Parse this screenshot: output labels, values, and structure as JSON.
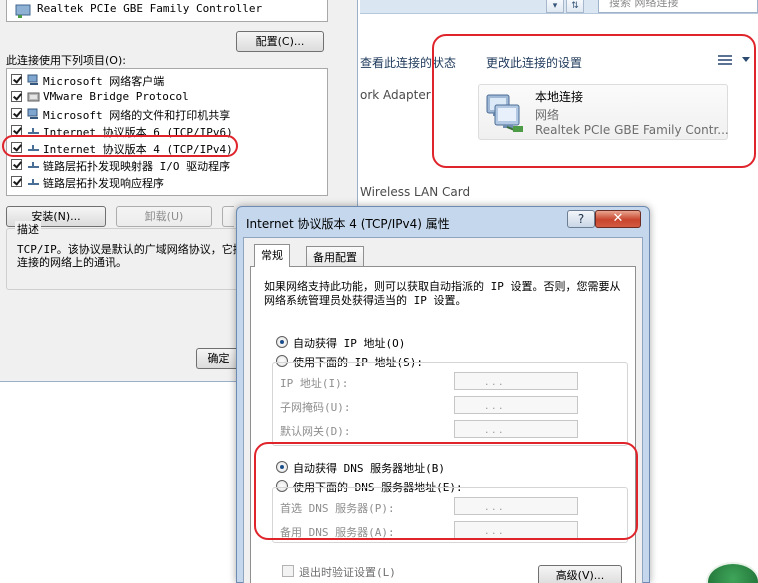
{
  "explorer": {
    "search_placeholder": "搜索 网络连接",
    "cmd_status": "查看此连接的状态",
    "cmd_settings": "更改此连接的设置",
    "adapter_row1": "ork Adapter",
    "adapter_row2": "Wireless LAN Card",
    "lan": {
      "name": "本地连接",
      "status": "网络",
      "device": "Realtek PCIe GBE Family Contr..."
    }
  },
  "props": {
    "device": "Realtek PCIe GBE Family Controller",
    "configure_button": "配置(C)...",
    "uses_label": "此连接使用下列项目(O):",
    "items": [
      {
        "label": "Microsoft 网络客户端",
        "checked": true
      },
      {
        "label": "VMware Bridge Protocol",
        "checked": true
      },
      {
        "label": "Microsoft 网络的文件和打印机共享",
        "checked": true
      },
      {
        "label": "Internet 协议版本 6 (TCP/IPv6)",
        "checked": true
      },
      {
        "label": "Internet 协议版本 4 (TCP/IPv4)",
        "checked": true
      },
      {
        "label": "链路层拓扑发现映射器 I/O 驱动程序",
        "checked": true
      },
      {
        "label": "链路层拓扑发现响应程序",
        "checked": true
      }
    ],
    "install_button": "安装(N)...",
    "uninstall_button": "卸载(U)",
    "desc_title": "描述",
    "desc_text": "TCP/IP。该协议是默认的广域网络协议，它提供在不同的相互连接的网络上的通讯。",
    "ok_button": "确定"
  },
  "dialog": {
    "title": "Internet 协议版本 4 (TCP/IPv4) 属性",
    "help_button": "?",
    "close_button": "✕",
    "tab_general": "常规",
    "tab_alternate": "备用配置",
    "intro": "如果网络支持此功能，则可以获取自动指派的 IP 设置。否则，您需要从网络系统管理员处获得适当的 IP 设置。",
    "auto_ip": "自动获得 IP 地址(O)",
    "manual_ip": "使用下面的 IP 地址(S):",
    "ip_address_label": "IP 地址(I):",
    "subnet_label": "子网掩码(U):",
    "gateway_label": "默认网关(D):",
    "auto_dns": "自动获得 DNS 服务器地址(B)",
    "manual_dns": "使用下面的 DNS 服务器地址(E):",
    "preferred_dns_label": "首选 DNS 服务器(P):",
    "alternate_dns_label": "备用 DNS 服务器(A):",
    "validate_on_exit": "退出时验证设置(L)",
    "advanced_button": "高级(V)...",
    "ip_dots": ". . ."
  },
  "colors": {
    "highlight_red": "#e0242b",
    "link_blue": "#1e395b"
  }
}
